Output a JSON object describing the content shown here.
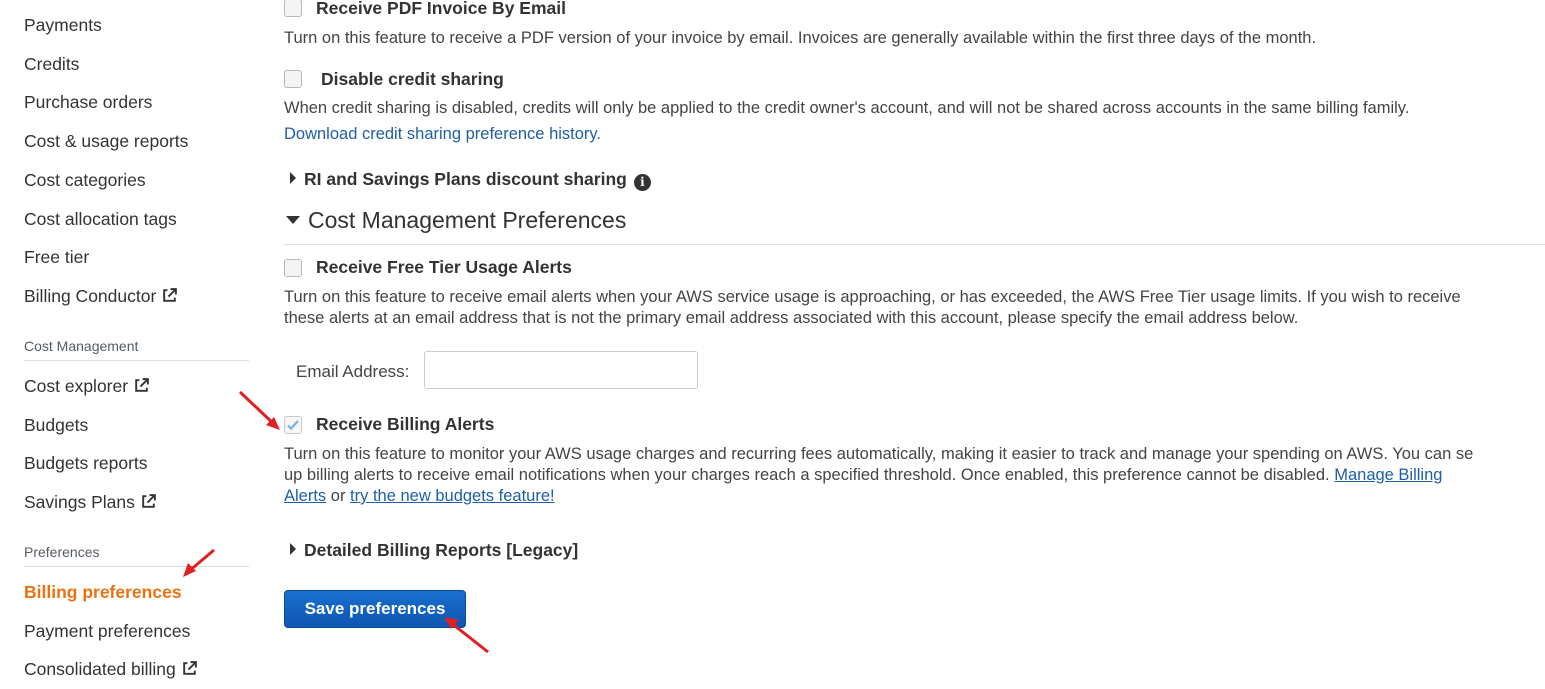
{
  "sidebar": {
    "items_top": [
      {
        "label": "Payments"
      },
      {
        "label": "Credits"
      },
      {
        "label": "Purchase orders"
      },
      {
        "label": "Cost & usage reports"
      },
      {
        "label": "Cost categories"
      },
      {
        "label": "Cost allocation tags"
      },
      {
        "label": "Free tier"
      },
      {
        "label": "Billing Conductor",
        "icon": "external-link-icon"
      }
    ],
    "cost_management": {
      "header": "Cost Management",
      "items": [
        {
          "label": "Cost explorer",
          "icon": "external-link-icon"
        },
        {
          "label": "Budgets"
        },
        {
          "label": "Budgets reports"
        },
        {
          "label": "Savings Plans",
          "icon": "external-link-icon"
        }
      ]
    },
    "preferences": {
      "header": "Preferences",
      "items": [
        {
          "label": "Billing preferences",
          "active": true
        },
        {
          "label": "Payment preferences"
        },
        {
          "label": "Consolidated billing",
          "icon": "external-link-icon"
        }
      ]
    }
  },
  "main": {
    "pdf_invoice": {
      "label": "Receive PDF Invoice By Email",
      "checked": false,
      "description": "Turn on this feature to receive a PDF version of your invoice by email. Invoices are generally available within the first three days of the month."
    },
    "credit_sharing": {
      "label": "Disable credit sharing",
      "checked": false,
      "description": "When credit sharing is disabled, credits will only be applied to the credit owner's account, and will not be shared across accounts in the same billing family.",
      "link": "Download credit sharing preference history."
    },
    "ri_sharing": {
      "label": "RI and Savings Plans discount sharing",
      "expanded": false,
      "icon": "info-icon"
    },
    "cost_mgmt_prefs": {
      "heading": "Cost Management Preferences",
      "expanded": true
    },
    "free_tier_alerts": {
      "label": "Receive Free Tier Usage Alerts",
      "checked": false,
      "description_line1": "Turn on this feature to receive email alerts when your AWS service usage is approaching, or has exceeded, the AWS Free Tier usage limits. If you wish to receive",
      "description_line2": "these alerts at an email address that is not the primary email address associated with this account, please specify the email address below.",
      "email_label": "Email Address:",
      "email_value": ""
    },
    "billing_alerts": {
      "label": "Receive Billing Alerts",
      "checked": true,
      "description_line1": "Turn on this feature to monitor your AWS usage charges and recurring fees automatically, making it easier to track and manage your spending on AWS. You can se",
      "description_line2": "up billing alerts to receive email notifications when your charges reach a specified threshold. Once enabled, this preference cannot be disabled.",
      "manage_link_part1": "Manage Billing",
      "manage_link_part2": "Alerts",
      "or_text": "or",
      "budgets_link": "try the new budgets feature!"
    },
    "detailed_reports": {
      "label": "Detailed Billing Reports [Legacy]",
      "expanded": false
    },
    "save_button": "Save preferences"
  },
  "colors": {
    "accent_active": "#ec7211",
    "link": "#1f5ea8",
    "button": "#0d56b0",
    "annotation_arrow": "#e02020"
  }
}
